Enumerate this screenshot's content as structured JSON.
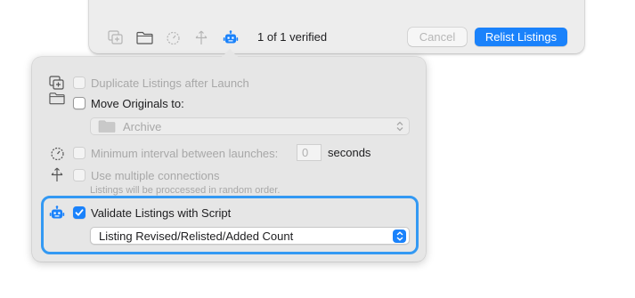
{
  "toolbar": {
    "status": "1 of 1 verified",
    "cancel_label": "Cancel",
    "relist_label": "Relist Listings",
    "icons": [
      "duplicate-icon",
      "folder-icon",
      "stopwatch-icon",
      "connections-icon",
      "robot-icon"
    ]
  },
  "options": {
    "duplicate": {
      "label": "Duplicate Listings after Launch",
      "checked": false,
      "enabled": false
    },
    "move_originals": {
      "label": "Move Originals to:",
      "checked": false,
      "enabled": true
    },
    "archive_folder": {
      "value": "Archive",
      "enabled": false
    },
    "min_interval": {
      "label": "Minimum interval between launches:",
      "value": "0",
      "unit": "seconds",
      "enabled": false
    },
    "multiple_connections": {
      "label": "Use multiple connections",
      "note": "Listings will be proccessed in random order.",
      "enabled": false
    },
    "validate": {
      "label": "Validate Listings with Script",
      "checked": true,
      "enabled": true
    },
    "script_select": {
      "value": "Listing Revised/Relisted/Added Count"
    }
  },
  "colors": {
    "accent": "#1a82fb",
    "highlight": "#3399f3",
    "popover_bg": "#e6e6e6",
    "toolbar_bg": "#ededed"
  }
}
